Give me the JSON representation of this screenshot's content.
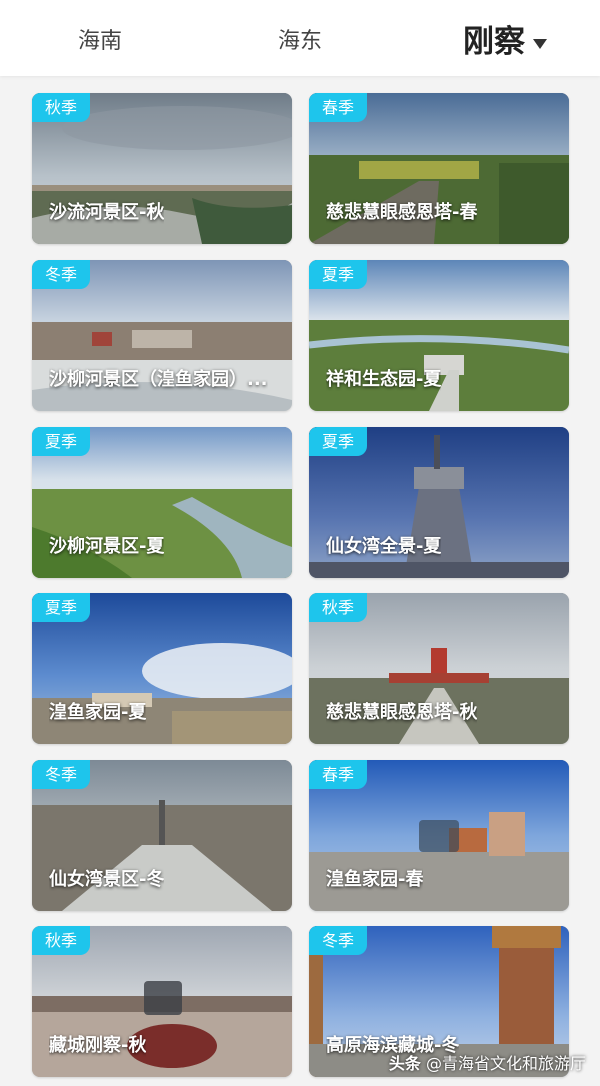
{
  "tabs": [
    {
      "label": "海南",
      "active": false
    },
    {
      "label": "海东",
      "active": false
    },
    {
      "label": "刚察",
      "active": true
    }
  ],
  "cards": [
    {
      "season": "秋季",
      "title": "沙流河景区-秋"
    },
    {
      "season": "春季",
      "title": "慈悲慧眼感恩塔-春"
    },
    {
      "season": "冬季",
      "title": "沙柳河景区（湟鱼家园）..."
    },
    {
      "season": "夏季",
      "title": "祥和生态园-夏"
    },
    {
      "season": "夏季",
      "title": "沙柳河景区-夏"
    },
    {
      "season": "夏季",
      "title": "仙女湾全景-夏"
    },
    {
      "season": "夏季",
      "title": "湟鱼家园-夏"
    },
    {
      "season": "秋季",
      "title": "慈悲慧眼感恩塔-秋"
    },
    {
      "season": "冬季",
      "title": "仙女湾景区-冬"
    },
    {
      "season": "春季",
      "title": "湟鱼家园-春"
    },
    {
      "season": "秋季",
      "title": "藏城刚察-秋"
    },
    {
      "season": "冬季",
      "title": "高原海滨藏城-冬"
    }
  ],
  "watermark": {
    "brand": "头条",
    "author": "@青海省文化和旅游厅"
  },
  "colors": {
    "badge": "#1ec5ec",
    "active_tab": "#222222"
  }
}
